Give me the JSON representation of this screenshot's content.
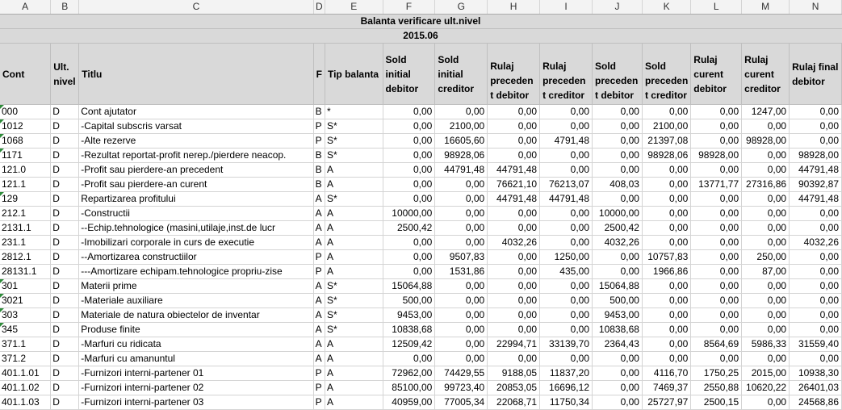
{
  "columns": [
    "A",
    "B",
    "C",
    "D",
    "E",
    "F",
    "G",
    "H",
    "I",
    "J",
    "K",
    "L",
    "M",
    "N"
  ],
  "title": "Balanta verificare ult.nivel",
  "period": "2015.06",
  "headers": {
    "cont": "Cont",
    "ult": "Ult. nivel",
    "titlu": "Titlu",
    "f": "F",
    "tip": "Tip balanta",
    "sid": "Sold initial debitor",
    "sic": "Sold initial creditor",
    "rpd": "Rulaj preceden t debitor",
    "rpc": "Rulaj preceden t creditor",
    "spd": "Sold preceden t debitor",
    "spc": "Sold preceden t creditor",
    "rcd": "Rulaj curent debitor",
    "rcc": "Rulaj curent creditor",
    "rfd": "Rulaj final debitor"
  },
  "rows": [
    {
      "cont": "000",
      "ult": "D",
      "titlu": "Cont ajutator",
      "f": "B",
      "tip": "*",
      "v": [
        "0,00",
        "0,00",
        "0,00",
        "0,00",
        "0,00",
        "0,00",
        "0,00",
        "1247,00",
        "0,00"
      ],
      "mark": true
    },
    {
      "cont": "1012",
      "ult": "D",
      "titlu": "-Capital subscris varsat",
      "f": "P",
      "tip": "S*",
      "v": [
        "0,00",
        "2100,00",
        "0,00",
        "0,00",
        "0,00",
        "2100,00",
        "0,00",
        "0,00",
        "0,00"
      ],
      "mark": true
    },
    {
      "cont": "1068",
      "ult": "D",
      "titlu": "-Alte rezerve",
      "f": "P",
      "tip": "S*",
      "v": [
        "0,00",
        "16605,60",
        "0,00",
        "4791,48",
        "0,00",
        "21397,08",
        "0,00",
        "98928,00",
        "0,00"
      ],
      "mark": true
    },
    {
      "cont": "1171",
      "ult": "D",
      "titlu": "-Rezultat reportat-profit nerep./pierdere neacop.",
      "f": "B",
      "tip": "S*",
      "v": [
        "0,00",
        "98928,06",
        "0,00",
        "0,00",
        "0,00",
        "98928,06",
        "98928,00",
        "0,00",
        "98928,00"
      ],
      "mark": true
    },
    {
      "cont": "121.0",
      "ult": "D",
      "titlu": "-Profit sau pierdere-an precedent",
      "f": "B",
      "tip": "A",
      "v": [
        "0,00",
        "44791,48",
        "44791,48",
        "0,00",
        "0,00",
        "0,00",
        "0,00",
        "0,00",
        "44791,48"
      ],
      "mark": false
    },
    {
      "cont": "121.1",
      "ult": "D",
      "titlu": "-Profit sau pierdere-an curent",
      "f": "B",
      "tip": "A",
      "v": [
        "0,00",
        "0,00",
        "76621,10",
        "76213,07",
        "408,03",
        "0,00",
        "13771,77",
        "27316,86",
        "90392,87"
      ],
      "mark": false
    },
    {
      "cont": "129",
      "ult": "D",
      "titlu": "Repartizarea profitului",
      "f": "A",
      "tip": "S*",
      "v": [
        "0,00",
        "0,00",
        "44791,48",
        "44791,48",
        "0,00",
        "0,00",
        "0,00",
        "0,00",
        "44791,48"
      ],
      "mark": true
    },
    {
      "cont": "212.1",
      "ult": "D",
      "titlu": "-Constructii",
      "f": "A",
      "tip": "A",
      "v": [
        "10000,00",
        "0,00",
        "0,00",
        "0,00",
        "10000,00",
        "0,00",
        "0,00",
        "0,00",
        "0,00"
      ],
      "mark": false
    },
    {
      "cont": "2131.1",
      "ult": "D",
      "titlu": "--Echip.tehnologice (masini,utilaje,inst.de lucr",
      "f": "A",
      "tip": "A",
      "v": [
        "2500,42",
        "0,00",
        "0,00",
        "0,00",
        "2500,42",
        "0,00",
        "0,00",
        "0,00",
        "0,00"
      ],
      "mark": false
    },
    {
      "cont": "231.1",
      "ult": "D",
      "titlu": "-Imobilizari corporale in curs de executie",
      "f": "A",
      "tip": "A",
      "v": [
        "0,00",
        "0,00",
        "4032,26",
        "0,00",
        "4032,26",
        "0,00",
        "0,00",
        "0,00",
        "4032,26"
      ],
      "mark": false
    },
    {
      "cont": "2812.1",
      "ult": "D",
      "titlu": "--Amortizarea constructiilor",
      "f": "P",
      "tip": "A",
      "v": [
        "0,00",
        "9507,83",
        "0,00",
        "1250,00",
        "0,00",
        "10757,83",
        "0,00",
        "250,00",
        "0,00"
      ],
      "mark": false
    },
    {
      "cont": "28131.1",
      "ult": "D",
      "titlu": "---Amortizare echipam.tehnologice propriu-zise",
      "f": "P",
      "tip": "A",
      "v": [
        "0,00",
        "1531,86",
        "0,00",
        "435,00",
        "0,00",
        "1966,86",
        "0,00",
        "87,00",
        "0,00"
      ],
      "mark": false
    },
    {
      "cont": "301",
      "ult": "D",
      "titlu": "Materii prime",
      "f": "A",
      "tip": "S*",
      "v": [
        "15064,88",
        "0,00",
        "0,00",
        "0,00",
        "15064,88",
        "0,00",
        "0,00",
        "0,00",
        "0,00"
      ],
      "mark": true
    },
    {
      "cont": "3021",
      "ult": "D",
      "titlu": "-Materiale auxiliare",
      "f": "A",
      "tip": "S*",
      "v": [
        "500,00",
        "0,00",
        "0,00",
        "0,00",
        "500,00",
        "0,00",
        "0,00",
        "0,00",
        "0,00"
      ],
      "mark": true
    },
    {
      "cont": "303",
      "ult": "D",
      "titlu": "Materiale de natura obiectelor de inventar",
      "f": "A",
      "tip": "S*",
      "v": [
        "9453,00",
        "0,00",
        "0,00",
        "0,00",
        "9453,00",
        "0,00",
        "0,00",
        "0,00",
        "0,00"
      ],
      "mark": true
    },
    {
      "cont": "345",
      "ult": "D",
      "titlu": "Produse finite",
      "f": "A",
      "tip": "S*",
      "v": [
        "10838,68",
        "0,00",
        "0,00",
        "0,00",
        "10838,68",
        "0,00",
        "0,00",
        "0,00",
        "0,00"
      ],
      "mark": true
    },
    {
      "cont": "371.1",
      "ult": "D",
      "titlu": "-Marfuri cu ridicata",
      "f": "A",
      "tip": "A",
      "v": [
        "12509,42",
        "0,00",
        "22994,71",
        "33139,70",
        "2364,43",
        "0,00",
        "8564,69",
        "5986,33",
        "31559,40"
      ],
      "mark": false
    },
    {
      "cont": "371.2",
      "ult": "D",
      "titlu": "-Marfuri cu amanuntul",
      "f": "A",
      "tip": "A",
      "v": [
        "0,00",
        "0,00",
        "0,00",
        "0,00",
        "0,00",
        "0,00",
        "0,00",
        "0,00",
        "0,00"
      ],
      "mark": false
    },
    {
      "cont": "401.1.01",
      "ult": "D",
      "titlu": "-Furnizori interni-partener 01",
      "f": "P",
      "tip": "A",
      "v": [
        "72962,00",
        "74429,55",
        "9188,05",
        "11837,20",
        "0,00",
        "4116,70",
        "1750,25",
        "2015,00",
        "10938,30"
      ],
      "mark": false
    },
    {
      "cont": "401.1.02",
      "ult": "D",
      "titlu": "-Furnizori interni-partener 02",
      "f": "P",
      "tip": "A",
      "v": [
        "85100,00",
        "99723,40",
        "20853,05",
        "16696,12",
        "0,00",
        "7469,37",
        "2550,88",
        "10620,22",
        "26401,03"
      ],
      "mark": false
    },
    {
      "cont": "401.1.03",
      "ult": "D",
      "titlu": "-Furnizori interni-partener 03",
      "f": "P",
      "tip": "A",
      "v": [
        "40959,00",
        "77005,34",
        "22068,71",
        "11750,34",
        "0,00",
        "25727,97",
        "2500,15",
        "0,00",
        "24568,86"
      ],
      "mark": false
    }
  ]
}
